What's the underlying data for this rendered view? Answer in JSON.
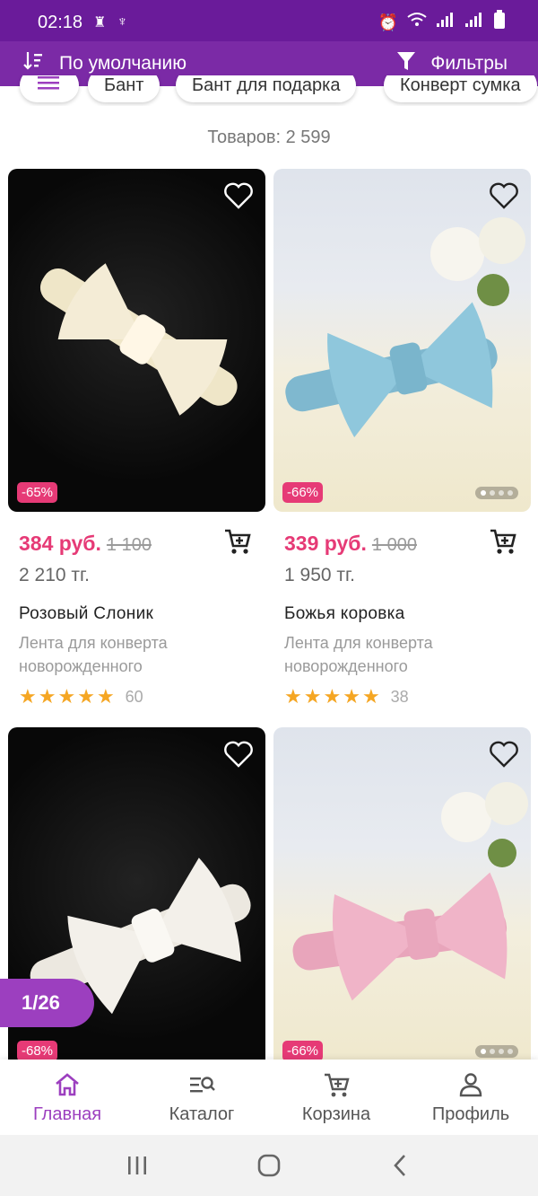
{
  "status_bar": {
    "time": "02:18"
  },
  "toolbar": {
    "sort_label": "По умолчанию",
    "filter_label": "Фильтры"
  },
  "chips": [
    "Бант",
    "Бант для подарка",
    "Конверт сумка"
  ],
  "product_count": "Товаров: 2 599",
  "products": [
    {
      "discount": "-65%",
      "price": "384 руб.",
      "old_price": "1 100",
      "alt_price": "2 210 тг.",
      "title": "Розовый Слоник",
      "subtitle": "Лента для конверта новорожденного",
      "rating_count": "60",
      "bow_color": "#f4ecd6",
      "band_color": "#efe6c8"
    },
    {
      "discount": "-66%",
      "price": "339 руб.",
      "old_price": "1 000",
      "alt_price": "1 950 тг.",
      "title": "Божья коровка",
      "subtitle": "Лента для конверта новорожденного",
      "rating_count": "38",
      "bow_color": "#8fc7dc",
      "band_color": "#7fb8cf"
    },
    {
      "discount": "-68%",
      "bow_color": "#f3f0ea",
      "band_color": "#ece8e0"
    },
    {
      "discount": "-66%",
      "bow_color": "#f0b4c8",
      "band_color": "#e8a5bb"
    }
  ],
  "page_indicator": "1/26",
  "bottom_nav": [
    {
      "label": "Главная",
      "icon": "home-icon"
    },
    {
      "label": "Каталог",
      "icon": "catalog-search-icon"
    },
    {
      "label": "Корзина",
      "icon": "cart-icon"
    },
    {
      "label": "Профиль",
      "icon": "profile-icon"
    }
  ],
  "colors": {
    "brand": "#7b2aa6",
    "accent": "#e63a76",
    "active_nav": "#9c3fbf",
    "star": "#f5a623"
  }
}
